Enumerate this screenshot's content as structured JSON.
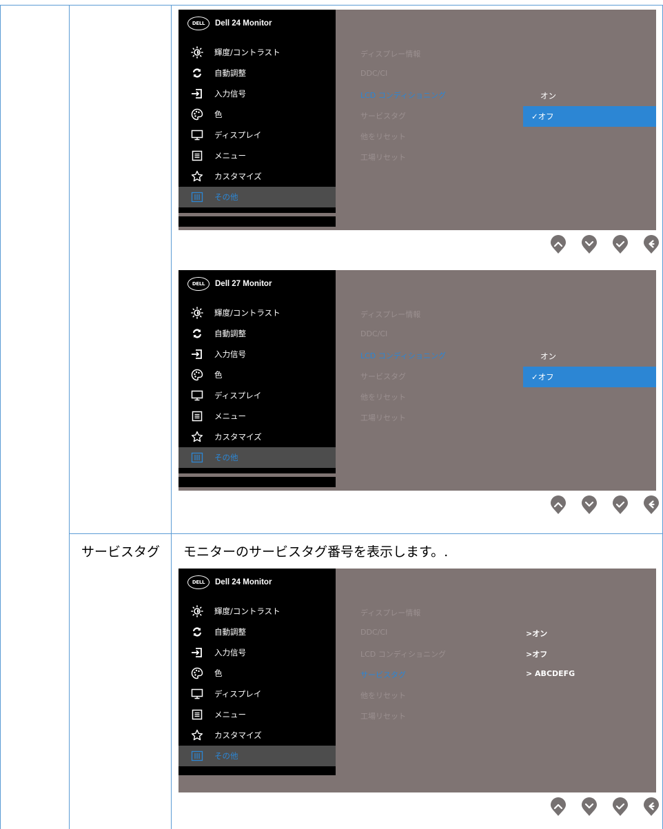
{
  "row_label": "サービスタグ",
  "description": "モニターのサービスタグ番号を表示します。.",
  "menu_items": [
    {
      "label": "輝度/コントラスト",
      "icon": "brightness-icon"
    },
    {
      "label": "自動調整",
      "icon": "auto-adjust-icon"
    },
    {
      "label": "入力信号",
      "icon": "input-source-icon"
    },
    {
      "label": "色",
      "icon": "color-palette-icon"
    },
    {
      "label": "ディスプレイ",
      "icon": "display-icon"
    },
    {
      "label": "メニュー",
      "icon": "menu-icon"
    },
    {
      "label": "カスタマイズ",
      "icon": "star-icon"
    },
    {
      "label": "その他",
      "icon": "others-icon"
    }
  ],
  "submenu": [
    "ディスプレー情報",
    "DDC/CI",
    "LCD コンディショニング",
    "サービスタグ",
    "他をリセット",
    "工場リセット"
  ],
  "osd1": {
    "model": "Dell 24 Monitor",
    "opt_on": "オン",
    "opt_off": "✓オフ"
  },
  "osd2": {
    "model": "Dell 27 Monitor",
    "opt_on": "オン",
    "opt_off": "✓オフ"
  },
  "osd3": {
    "model": "Dell 24 Monitor",
    "ddc_value": ">オン",
    "lcd_value": ">オフ",
    "tag_value": "> ABCDEFG"
  },
  "logo_text": "DELL",
  "colors": {
    "accent": "#2c86d4",
    "panel": "#000000",
    "background": "#7f7473",
    "border": "#5b9bd5"
  }
}
